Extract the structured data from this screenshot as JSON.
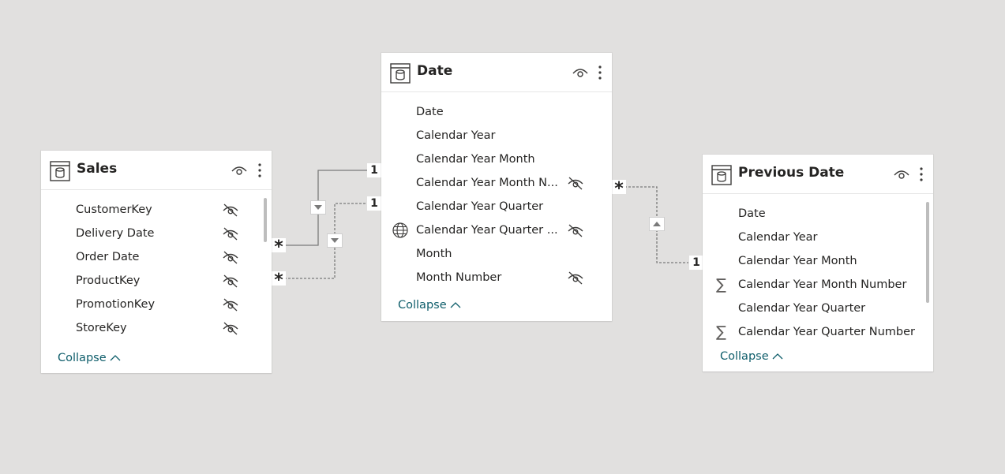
{
  "tables": {
    "sales": {
      "title": "Sales",
      "fields": [
        {
          "label": "CustomerKey",
          "hidden": true
        },
        {
          "label": "Delivery Date",
          "hidden": true
        },
        {
          "label": "Order Date",
          "hidden": true
        },
        {
          "label": "ProductKey",
          "hidden": true
        },
        {
          "label": "PromotionKey",
          "hidden": true
        },
        {
          "label": "StoreKey",
          "hidden": true
        }
      ],
      "collapse_label": "Collapse"
    },
    "date": {
      "title": "Date",
      "fields": [
        {
          "label": "Date",
          "hidden": false
        },
        {
          "label": "Calendar Year",
          "hidden": false
        },
        {
          "label": "Calendar Year Month",
          "hidden": false
        },
        {
          "label": "Calendar Year Month N...",
          "hidden": true
        },
        {
          "label": "Calendar Year Quarter",
          "hidden": false
        },
        {
          "label": "Calendar Year Quarter ...",
          "hidden": true,
          "icon": "globe-icon"
        },
        {
          "label": "Month",
          "hidden": false
        },
        {
          "label": "Month Number",
          "hidden": true
        }
      ],
      "collapse_label": "Collapse"
    },
    "previous_date": {
      "title": "Previous Date",
      "fields": [
        {
          "label": "Date",
          "hidden": false
        },
        {
          "label": "Calendar Year",
          "hidden": false
        },
        {
          "label": "Calendar Year Month",
          "hidden": false
        },
        {
          "label": "Calendar Year Month Number",
          "hidden": false,
          "icon": "sigma-icon"
        },
        {
          "label": "Calendar Year Quarter",
          "hidden": false
        },
        {
          "label": "Calendar Year Quarter Number",
          "hidden": false,
          "icon": "sigma-icon"
        }
      ],
      "collapse_label": "Collapse"
    }
  },
  "relationships": [
    {
      "from": "Sales",
      "to": "Date",
      "from_card": "*",
      "to_card": "1",
      "style": "solid",
      "direction": "down"
    },
    {
      "from": "Sales",
      "to": "Date",
      "from_card": "*",
      "to_card": "1",
      "style": "dashed",
      "direction": "down"
    },
    {
      "from": "Date",
      "to": "Previous Date",
      "from_card": "*",
      "to_card": "1",
      "style": "dashed",
      "direction": "up"
    }
  ],
  "colors": {
    "canvas": "#e1e0df",
    "card": "#ffffff",
    "link": "#0f5e6b",
    "icon": "#3b3a39"
  }
}
